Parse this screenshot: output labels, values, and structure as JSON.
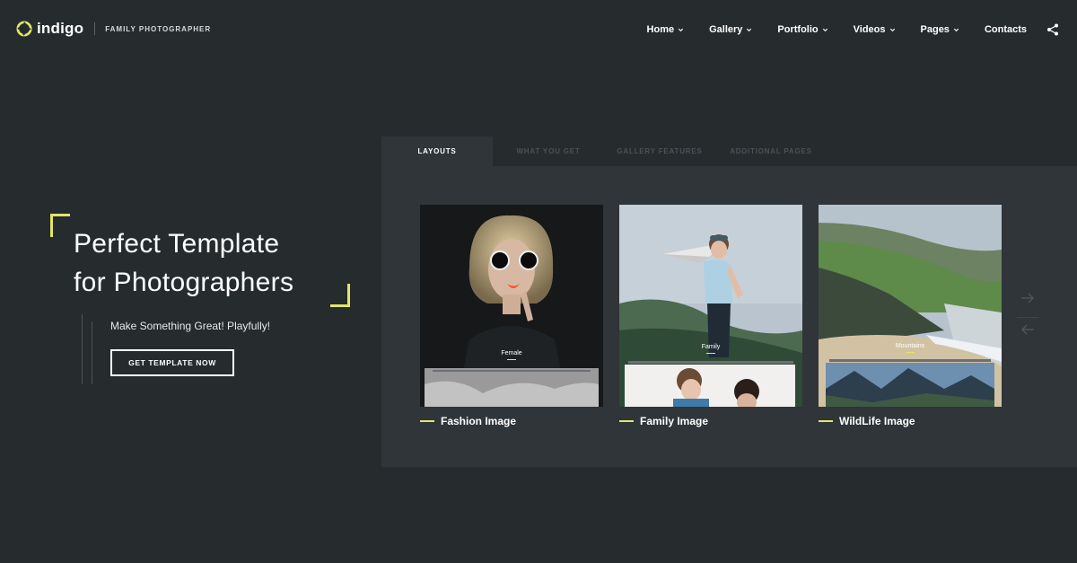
{
  "header": {
    "logo_text": "indigo",
    "logo_subtitle": "FAMILY PHOTOGRAPHER",
    "nav": [
      {
        "label": "Home",
        "has_dropdown": true
      },
      {
        "label": "Gallery",
        "has_dropdown": true
      },
      {
        "label": "Portfolio",
        "has_dropdown": true
      },
      {
        "label": "Videos",
        "has_dropdown": true
      },
      {
        "label": "Pages",
        "has_dropdown": true
      },
      {
        "label": "Contacts",
        "has_dropdown": false
      }
    ],
    "share_icon": "share-icon"
  },
  "hero": {
    "title_line1": "Perfect Template",
    "title_line2": "for Photographers",
    "subtitle": "Make Something Great! Playfully!",
    "cta_label": "GET TEMPLATE NOW"
  },
  "panel": {
    "tabs": [
      {
        "label": "LAYOUTS",
        "active": true
      },
      {
        "label": "WHAT YOU GET",
        "active": false
      },
      {
        "label": "GALLERY FEATURES",
        "active": false
      },
      {
        "label": "ADDITIONAL PAGES",
        "active": false
      }
    ],
    "cards": [
      {
        "tag": "Female",
        "caption": "Fashion Image"
      },
      {
        "tag": "Family",
        "caption": "Family Image"
      },
      {
        "tag": "Mountains",
        "caption": "WildLife Image"
      }
    ]
  },
  "colors": {
    "background": "#262c2e",
    "panel": "#2f3538",
    "accent": "#e3e56a",
    "text": "#ffffff"
  }
}
